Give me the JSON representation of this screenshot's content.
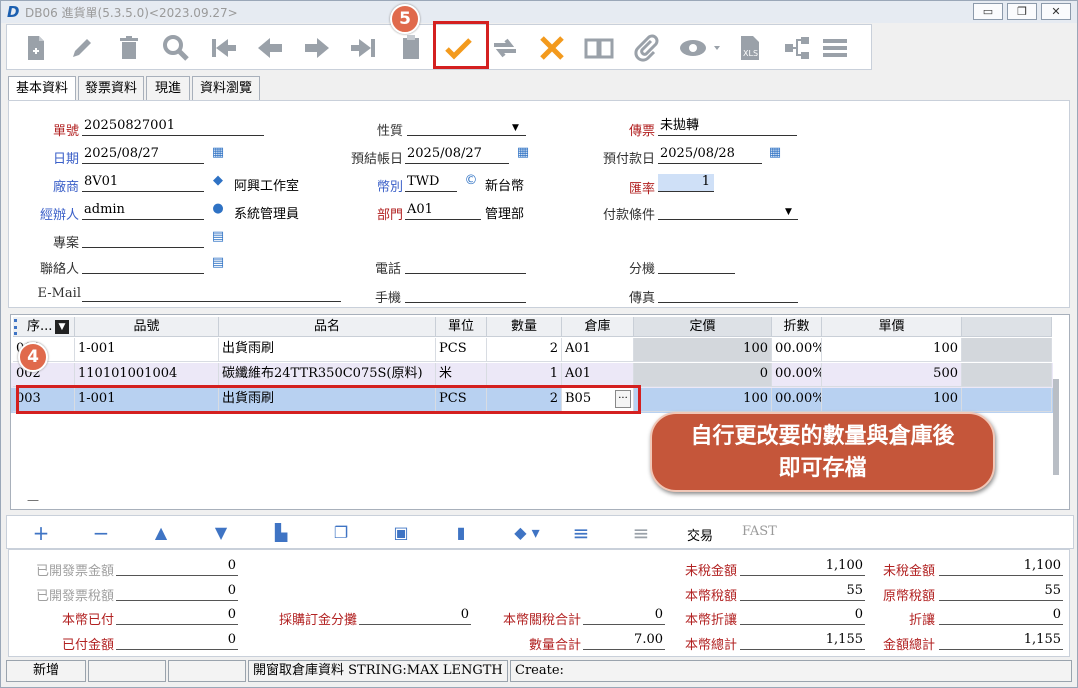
{
  "window": {
    "app_logo": "D",
    "title": "DB06 進貨單(5.3.5.0)<2023.09.27>",
    "minimize": "▭",
    "restore": "❐",
    "close": "✕"
  },
  "annotations": {
    "step5": "5",
    "step4": "4",
    "callout_line1": "自行更改要的數量與倉庫後",
    "callout_line2": "即可存檔"
  },
  "tabs": [
    "基本資料",
    "發票資料",
    "現進",
    "資料瀏覽"
  ],
  "form": {
    "doc_no": {
      "label": "單號",
      "value": "20250827001"
    },
    "nature": {
      "label": "性質",
      "value": ""
    },
    "voucher": {
      "label": "傳票",
      "value": "未拋轉"
    },
    "date": {
      "label": "日期",
      "value": "2025/08/27"
    },
    "settle_date": {
      "label": "預結帳日",
      "value": "2025/08/27"
    },
    "prepay_date": {
      "label": "預付款日",
      "value": "2025/08/28"
    },
    "vendor": {
      "label": "廠商",
      "value": "8V01",
      "name": "阿興工作室"
    },
    "currency": {
      "label": "幣別",
      "value": "TWD",
      "name": "新台幣"
    },
    "rate": {
      "label": "匯率",
      "value": "1"
    },
    "handler": {
      "label": "經辦人",
      "value": "admin",
      "name": "系統管理員"
    },
    "dept": {
      "label": "部門",
      "value": "A01",
      "name": "管理部"
    },
    "pay_terms": {
      "label": "付款條件",
      "value": ""
    },
    "project": {
      "label": "專案",
      "value": ""
    },
    "contact": {
      "label": "聯絡人",
      "value": ""
    },
    "phone": {
      "label": "電話",
      "value": ""
    },
    "ext": {
      "label": "分機",
      "value": ""
    },
    "email": {
      "label": "E-Mail",
      "value": ""
    },
    "mobile": {
      "label": "手機",
      "value": ""
    },
    "fax": {
      "label": "傳真",
      "value": ""
    }
  },
  "grid": {
    "headers": [
      "序...",
      "品號",
      "品名",
      "單位",
      "數量",
      "倉庫",
      "定價",
      "折數",
      "單價"
    ],
    "rows": [
      {
        "seq": "001",
        "item": "1-001",
        "name": "出貨雨刷",
        "unit": "PCS",
        "qty": "2",
        "wh": "A01",
        "price": "100",
        "disc": "00.00%",
        "unit_price": "100"
      },
      {
        "seq": "002",
        "item": "110101001004",
        "name": "碳纖維布24TTR350C075S(原料)",
        "unit": "米",
        "qty": "1",
        "wh": "A01",
        "price": "0",
        "disc": "00.00%",
        "unit_price": "500"
      },
      {
        "seq": "003",
        "item": "1-001",
        "name": "出貨雨刷",
        "unit": "PCS",
        "qty": "2",
        "wh": "B05",
        "price": "100",
        "disc": "00.00%",
        "unit_price": "100"
      }
    ],
    "ellipsis": "···",
    "grip": "—"
  },
  "rowbar": {
    "trade": "交易",
    "fast": "FAST"
  },
  "totals": {
    "invoiced_amount": {
      "label": "已開發票金額",
      "value": "0"
    },
    "invoiced_tax": {
      "label": "已開發票稅額",
      "value": "0"
    },
    "local_paid": {
      "label": "本幣已付",
      "value": "0"
    },
    "paid_amount": {
      "label": "已付金額",
      "value": "0"
    },
    "po_deposit": {
      "label": "採購訂金分攤",
      "value": "0"
    },
    "customs_total": {
      "label": "本幣關稅合計",
      "value": "0"
    },
    "qty_total": {
      "label": "數量合計",
      "value": "7.00"
    },
    "untaxed1": {
      "label": "未稅金額",
      "value": "1,100"
    },
    "local_tax": {
      "label": "本幣稅額",
      "value": "55"
    },
    "local_discount": {
      "label": "本幣折讓",
      "value": "0"
    },
    "local_total": {
      "label": "本幣總計",
      "value": "1,155"
    },
    "untaxed2": {
      "label": "未稅金額",
      "value": "1,100"
    },
    "orig_tax": {
      "label": "原幣稅額",
      "value": "55"
    },
    "discount": {
      "label": "折讓",
      "value": "0"
    },
    "amount_total": {
      "label": "金額總計",
      "value": "1,155"
    }
  },
  "status": {
    "mode": "新增",
    "cell2": "",
    "cell3": "",
    "message": "開窗取倉庫資料 STRING:MAX LENGTH",
    "create": "Create:"
  },
  "colors": {
    "accent_red": "#d42020",
    "callout": "#c5563a",
    "selected_row": "#b8d1f1",
    "icon_blue": "#3f74c4"
  }
}
